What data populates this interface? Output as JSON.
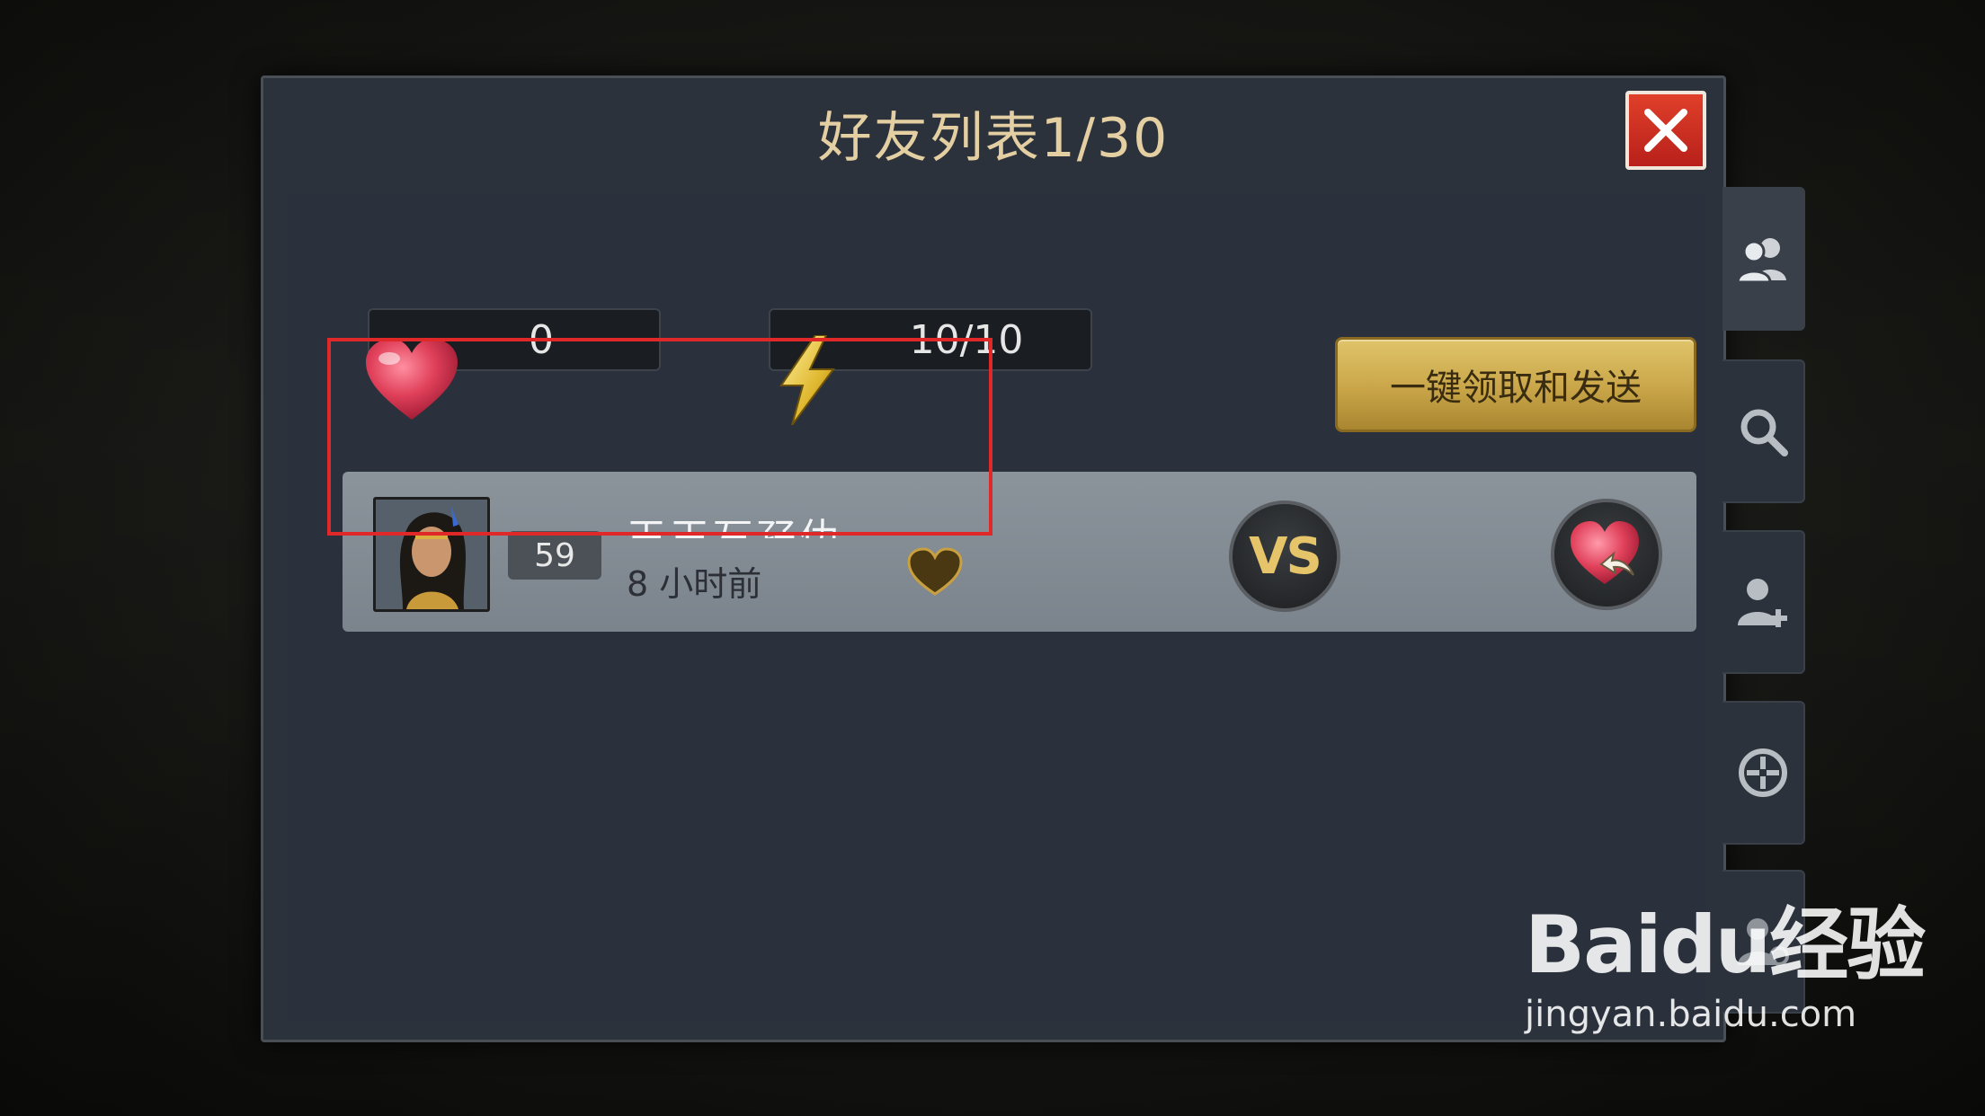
{
  "dialog": {
    "title": "好友列表1/30",
    "close_icon": "close-icon"
  },
  "counters": {
    "hearts": "0",
    "energy": "10/10"
  },
  "actions": {
    "claim_and_send_label": "一键领取和发送"
  },
  "friends": [
    {
      "level": "59",
      "name": "王王丂孖仂",
      "last_seen": "8 小时前",
      "vs_label": "VS"
    }
  ],
  "side_tabs": [
    {
      "icon": "friends-icon"
    },
    {
      "icon": "search-icon"
    },
    {
      "icon": "add-friend-icon"
    },
    {
      "icon": "crosshair-icon"
    },
    {
      "icon": "blocked-user-icon"
    }
  ],
  "watermark": {
    "logo": "Baidu经验",
    "url": "jingyan.baidu.com"
  },
  "colors": {
    "title": "#e4cfa3",
    "close": "#c82a1e",
    "gold_button": "#c9a548",
    "highlight": "#e02828",
    "vs": "#e6c46a"
  }
}
